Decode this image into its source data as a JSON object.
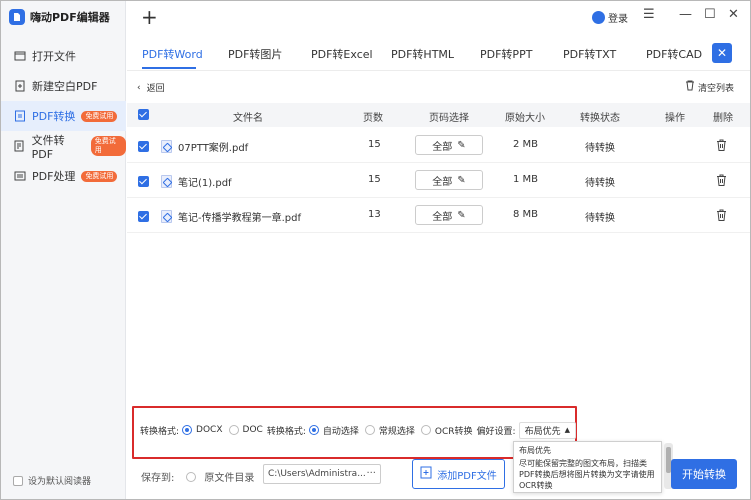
{
  "app": {
    "title": "嗨动PDF编辑器",
    "login": "登录"
  },
  "sidebar": {
    "items": [
      {
        "label": "打开文件",
        "icon": "folder-icon",
        "badge": ""
      },
      {
        "label": "新建空白PDF",
        "icon": "new-file-icon",
        "badge": ""
      },
      {
        "label": "PDF转换",
        "icon": "convert-icon",
        "badge": "免费试用",
        "active": true
      },
      {
        "label": "文件转PDF",
        "icon": "file-to-pdf-icon",
        "badge": "免费试用"
      },
      {
        "label": "PDF处理",
        "icon": "pdf-process-icon",
        "badge": "免费试用"
      }
    ],
    "default_reader": "设为默认阅读器"
  },
  "tabs": [
    {
      "label": "PDF转Word",
      "active": true
    },
    {
      "label": "PDF转图片"
    },
    {
      "label": "PDF转Excel"
    },
    {
      "label": "PDF转HTML"
    },
    {
      "label": "PDF转PPT"
    },
    {
      "label": "PDF转TXT"
    },
    {
      "label": "PDF转CAD"
    }
  ],
  "toolbar": {
    "back": "返回",
    "clear_list": "清空列表"
  },
  "table": {
    "headers": [
      "文件名",
      "页数",
      "页码选择",
      "原始大小",
      "转换状态",
      "操作",
      "删除"
    ],
    "rows": [
      {
        "name": "07PTT案例.pdf",
        "pages": "15",
        "page_select": "全部",
        "size": "2 MB",
        "status": "待转换"
      },
      {
        "name": "笔记(1).pdf",
        "pages": "15",
        "page_select": "全部",
        "size": "1 MB",
        "status": "待转换"
      },
      {
        "name": "笔记-传播学教程第一章.pdf",
        "pages": "13",
        "page_select": "全部",
        "size": "8 MB",
        "status": "待转换"
      }
    ]
  },
  "settings": {
    "format_label": "转换格式:",
    "format_docx": "DOCX",
    "format_doc": "DOC",
    "mode_label": "转换格式:",
    "mode_auto": "自动选择",
    "mode_normal": "常规选择",
    "mode_ocr": "OCR转换",
    "pref_label": "偏好设置:",
    "pref_value": "布局优先"
  },
  "dropdown": {
    "option": "布局优先",
    "description": "尽可能保留完整的图文布局，扫描类PDF转换后想将图片转换为文字请使用OCR转换"
  },
  "bottom": {
    "save_to": "保存到:",
    "original_dir": "原文件目录",
    "path": "C:\\Users\\Administra...",
    "path_more": "···",
    "add_pdf": "添加PDF文件",
    "start": "开始转换"
  },
  "colors": {
    "accent": "#2f6fe4",
    "badge": "#f26b3a",
    "highlight_box": "#d92b2b"
  }
}
